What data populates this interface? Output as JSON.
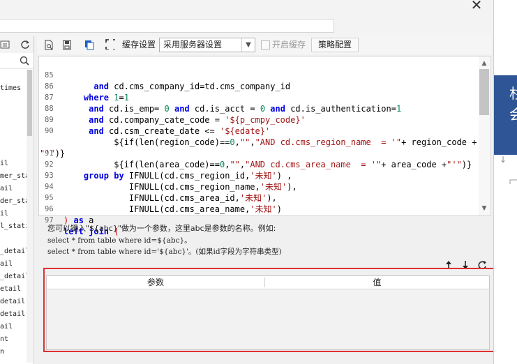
{
  "window": {
    "close_glyph": "✕"
  },
  "left_panel": {
    "tree_items": [
      "times",
      "il",
      "mer_stat",
      "ail",
      "der_stat",
      "il",
      "l_statis",
      "_detail",
      "ail",
      "_detail",
      "etail",
      "detail",
      "detail",
      "ail",
      "nt",
      "n"
    ]
  },
  "toolbar": {
    "cache_setting_label": "缓存设置",
    "cache_mode_value": "采用服务器设置",
    "enable_cache_label": "开启缓存",
    "strategy_button": "策略配置"
  },
  "editor": {
    "lines": [
      {
        "n": "85",
        "text": "      and cd.cms_company_id=td.cms_company_id"
      },
      {
        "n": "86",
        "text": "    where 1=1"
      },
      {
        "n": "87",
        "text": "     and cd.is_emp= 0 and cd.is_acct = 0 and cd.is_authentication=1"
      },
      {
        "n": "88",
        "text": "     and cd.company_cate_code = '${p_cmpy_code}'"
      },
      {
        "n": "89",
        "text": "     and cd.csm_create_date <= '${edate}'"
      },
      {
        "n": "90",
        "text": "          ${if(len(region_code)==0,\"\",\"AND cd.cms_region_name  = '\"+ region_code +"
      },
      {
        "n": "",
        "text": "\"'\")}"
      },
      {
        "n": "91",
        "text": "          ${if(len(area_code)==0,\"\",\"AND cd.cms_area_name  = '\"+ area_code +\"'\")}"
      },
      {
        "n": "92",
        "text": "    group by IFNULL(cd.cms_region_id,'未知') ,"
      },
      {
        "n": "93",
        "text": "             IFNULL(cd.cms_region_name,'未知'),"
      },
      {
        "n": "94",
        "text": "             IFNULL(cd.cms_area_id,'未知'),"
      },
      {
        "n": "95",
        "text": "             IFNULL(cd.cms_area_name,'未知')"
      },
      {
        "n": "96",
        "text": ") as a"
      },
      {
        "n": "97",
        "text": "left join ("
      }
    ]
  },
  "help": {
    "line1": "您可以键入\"${abc}\"做为一个参数，这里abc是参数的名称。例如:",
    "line2": "select * from table where id=${abc}。",
    "line3": "select * from table where id='${abc}'。(如果id字段为字符串类型)"
  },
  "params": {
    "col_param": "参数",
    "col_value": "值"
  },
  "right_panel": {
    "char1": "杉",
    "char2": "会"
  }
}
